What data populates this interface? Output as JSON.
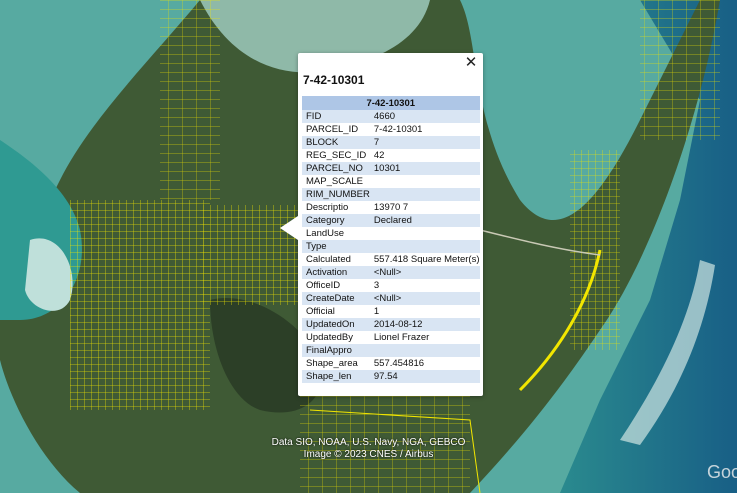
{
  "popup": {
    "title": "7-42-10301",
    "header": "7-42-10301",
    "close_glyph": "✕",
    "rows": [
      {
        "key": "FID",
        "value": "4660"
      },
      {
        "key": "PARCEL_ID",
        "value": "7-42-10301"
      },
      {
        "key": "BLOCK",
        "value": "7"
      },
      {
        "key": "REG_SEC_ID",
        "value": "42"
      },
      {
        "key": "PARCEL_NO",
        "value": "10301"
      },
      {
        "key": "MAP_SCALE",
        "value": ""
      },
      {
        "key": "RIM_NUMBER",
        "value": ""
      },
      {
        "key": "Descriptio",
        "value": "13970 7"
      },
      {
        "key": "Category",
        "value": "Declared"
      },
      {
        "key": "LandUse",
        "value": ""
      },
      {
        "key": "Type",
        "value": ""
      },
      {
        "key": "Calculated",
        "value": "557.418 Square Meter(s)"
      },
      {
        "key": "Activation",
        "value": "<Null>"
      },
      {
        "key": "OfficeID",
        "value": "3"
      },
      {
        "key": "CreateDate",
        "value": "<Null>"
      },
      {
        "key": "Official",
        "value": "1"
      },
      {
        "key": "UpdatedOn",
        "value": "2014-08-12"
      },
      {
        "key": "UpdatedBy",
        "value": "Lionel Frazer"
      },
      {
        "key": "FinalAppro",
        "value": ""
      },
      {
        "key": "Shape_area",
        "value": "557.454816"
      },
      {
        "key": "Shape_len",
        "value": "97.54"
      }
    ]
  },
  "map": {
    "attribution_line1": "Data SIO, NOAA, U.S. Navy, NGA, GEBCO",
    "attribution_line2": "Image © 2023 CNES / Airbus",
    "logo_text": "Goo",
    "colors": {
      "parcel_line": "#f2e600",
      "sea_light": "#4fa9a3",
      "sea_deep": "#1f6f8f",
      "land": "#3f5a35",
      "dark_land": "#2c3f27"
    }
  }
}
